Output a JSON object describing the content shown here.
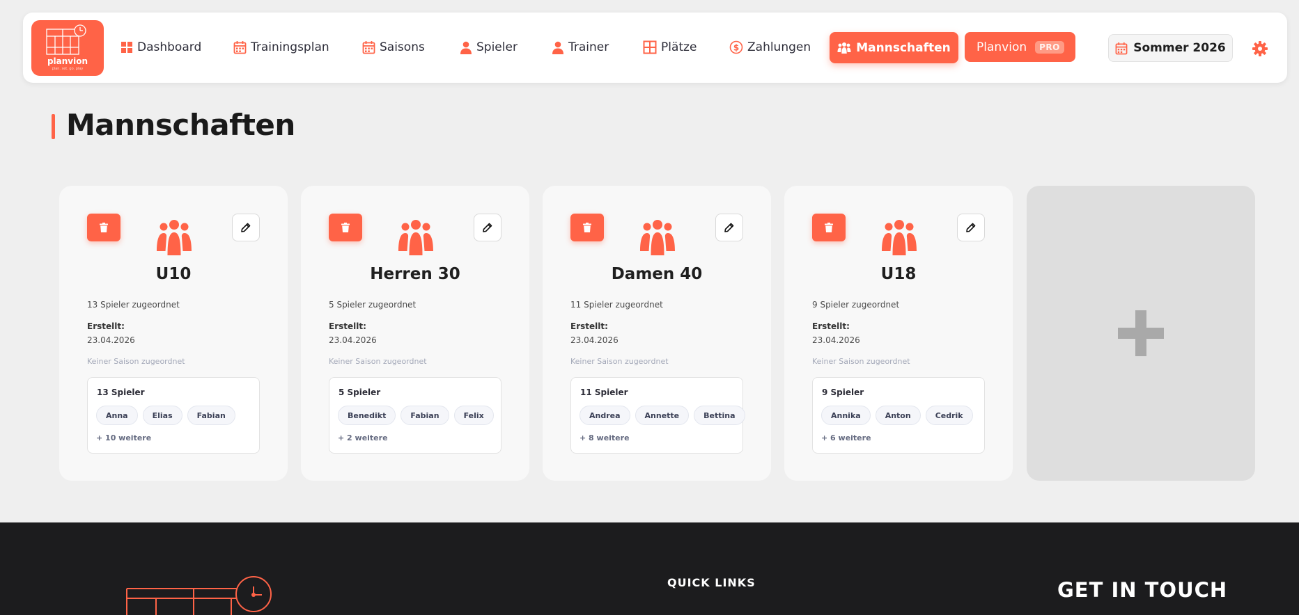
{
  "brand": {
    "name": "planvion",
    "tagline": "plan. set. go. play"
  },
  "nav": {
    "items": [
      {
        "label": "Dashboard",
        "icon": "grid-icon"
      },
      {
        "label": "Trainingsplan",
        "icon": "calendar-icon"
      },
      {
        "label": "Saisons",
        "icon": "calendar-icon"
      },
      {
        "label": "Spieler",
        "icon": "user-icon"
      },
      {
        "label": "Trainer",
        "icon": "user-icon"
      },
      {
        "label": "Plätze",
        "icon": "court-icon"
      },
      {
        "label": "Zahlungen",
        "icon": "dollar-icon"
      }
    ],
    "active": {
      "label": "Mannschaften",
      "icon": "team-icon"
    },
    "planvion": {
      "label": "Planvion",
      "badge": "PRO"
    },
    "season": {
      "label": "Sommer 2026",
      "icon": "calendar-icon"
    },
    "settings_icon": "gear-icon"
  },
  "page": {
    "title": "Mannschaften"
  },
  "teams": [
    {
      "name": "U10",
      "assigned": "13 Spieler zugeordnet",
      "created_label": "Erstellt:",
      "created_date": "23.04.2026",
      "season": "Keiner Saison zugeordnet",
      "players_count": "13 Spieler",
      "players": [
        "Anna",
        "Elias",
        "Fabian"
      ],
      "more": "+ 10 weitere"
    },
    {
      "name": "Herren 30",
      "assigned": "5 Spieler zugeordnet",
      "created_label": "Erstellt:",
      "created_date": "23.04.2026",
      "season": "Keiner Saison zugeordnet",
      "players_count": "5 Spieler",
      "players": [
        "Benedikt",
        "Fabian",
        "Felix"
      ],
      "more": "+ 2 weitere"
    },
    {
      "name": "Damen 40",
      "assigned": "11 Spieler zugeordnet",
      "created_label": "Erstellt:",
      "created_date": "23.04.2026",
      "season": "Keiner Saison zugeordnet",
      "players_count": "11 Spieler",
      "players": [
        "Andrea",
        "Annette",
        "Bettina"
      ],
      "more": "+ 8 weitere"
    },
    {
      "name": "U18",
      "assigned": "9 Spieler zugeordnet",
      "created_label": "Erstellt:",
      "created_date": "23.04.2026",
      "season": "Keiner Saison zugeordnet",
      "players_count": "9 Spieler",
      "players": [
        "Annika",
        "Anton",
        "Cedrik"
      ],
      "more": "+ 6 weitere"
    }
  ],
  "add_card": {
    "icon": "plus-icon"
  },
  "footer": {
    "quick_links": "QUICK LINKS",
    "get_in_touch": "GET IN TOUCH"
  },
  "colors": {
    "accent": "#ff6347",
    "background": "#efefef",
    "card": "#f8f8f8",
    "footer": "#1c1c1e"
  }
}
